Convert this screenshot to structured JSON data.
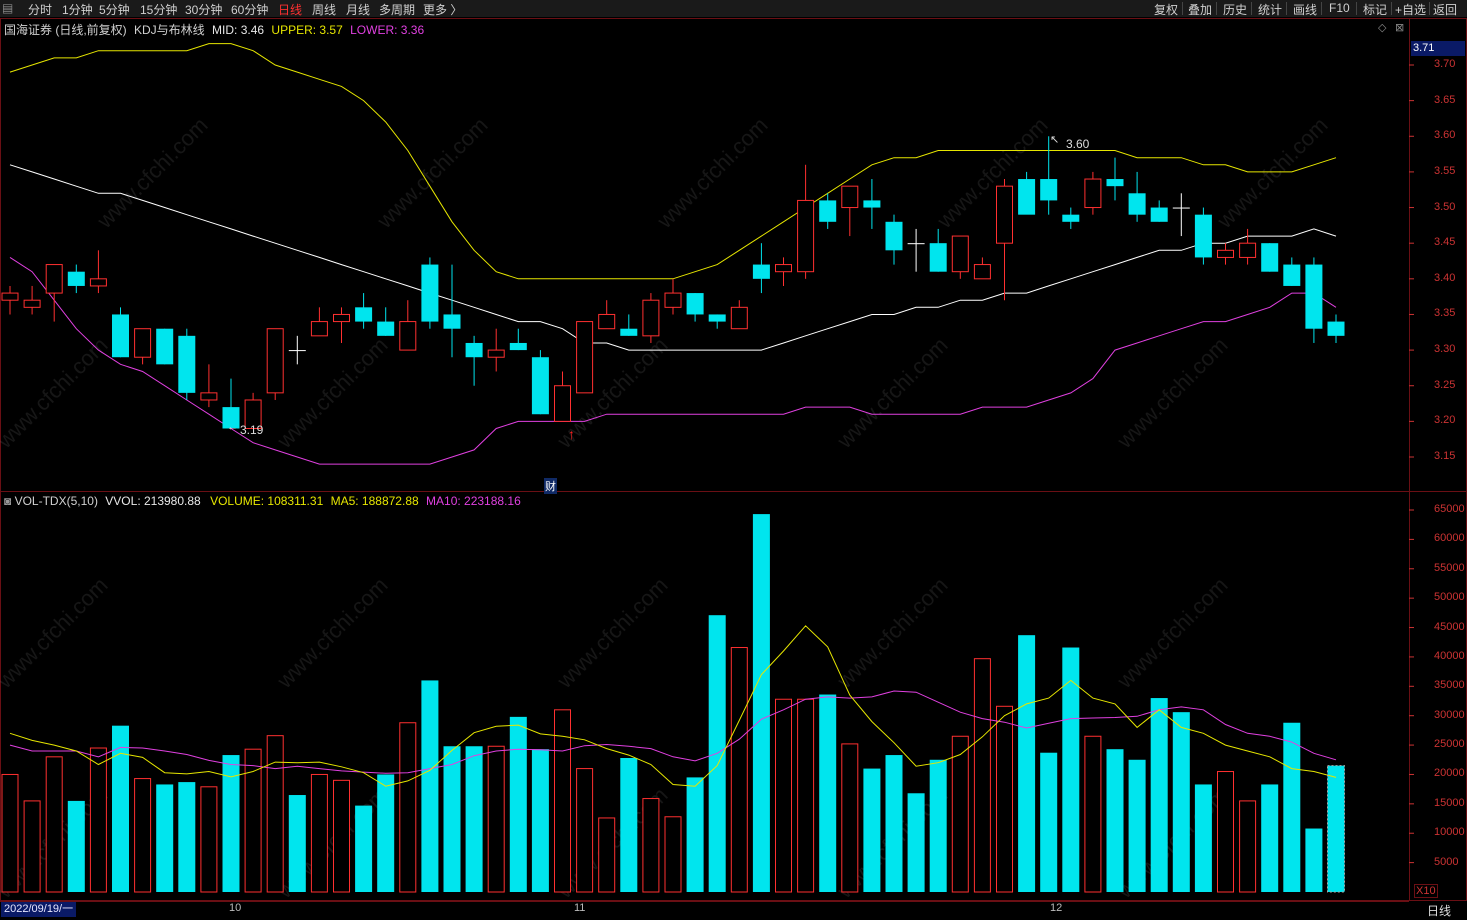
{
  "menu": {
    "periods": [
      "分时",
      "1分钟",
      "5分钟",
      "15分钟",
      "30分钟",
      "60分钟",
      "日线",
      "周线",
      "月线",
      "多周期",
      "更多 〉"
    ],
    "active": "日线",
    "right": [
      "复权",
      "叠加",
      "历史",
      "统计",
      "画线",
      "F10",
      "标记",
      "+自选",
      "返回"
    ]
  },
  "main_header": {
    "title": "国海证券 (日线,前复权)",
    "indicator": "KDJ与布林线",
    "mid": "MID: 3.46",
    "upper": "UPPER: 3.57",
    "lower": "LOWER: 3.36"
  },
  "vol_header": {
    "name": "VOL-TDX(5,10)",
    "vvol": "VVOL: 213980.88",
    "volume": "VOLUME: 108311.31",
    "ma5": "MA5: 188872.88",
    "ma10": "MA10: 223188.16"
  },
  "annotations": {
    "high": "3.60",
    "low": "3.19",
    "finance": "财"
  },
  "current_price": "3.71",
  "price_axis": [
    "3.70",
    "3.65",
    "3.60",
    "3.55",
    "3.50",
    "3.45",
    "3.40",
    "3.35",
    "3.30",
    "3.25",
    "3.20",
    "3.15"
  ],
  "vol_axis": [
    "65000",
    "60000",
    "55000",
    "50000",
    "45000",
    "40000",
    "35000",
    "30000",
    "25000",
    "20000",
    "15000",
    "10000",
    "5000"
  ],
  "vol_unit": "X10",
  "status": {
    "date": "2022/09/19/一",
    "months": [
      "10",
      "11",
      "12"
    ],
    "period": "日线"
  },
  "watermark": "www.cfchi.com",
  "colors": {
    "up": "#ff3030",
    "down": "#00e5ee",
    "mid": "#ffffff",
    "upper": "#e6e600",
    "lower": "#e040e0",
    "ma5": "#e6e600",
    "ma10": "#e040e0"
  },
  "chart_data": {
    "type": "candlestick",
    "candles": [
      [
        3.37,
        3.39,
        3.35,
        3.38
      ],
      [
        3.36,
        3.39,
        3.35,
        3.37
      ],
      [
        3.38,
        3.42,
        3.34,
        3.42
      ],
      [
        3.41,
        3.42,
        3.38,
        3.39
      ],
      [
        3.39,
        3.44,
        3.38,
        3.4
      ],
      [
        3.35,
        3.36,
        3.29,
        3.29
      ],
      [
        3.29,
        3.33,
        3.28,
        3.33
      ],
      [
        3.33,
        3.33,
        3.28,
        3.28
      ],
      [
        3.32,
        3.33,
        3.23,
        3.24
      ],
      [
        3.23,
        3.28,
        3.22,
        3.24
      ],
      [
        3.22,
        3.26,
        3.19,
        3.19
      ],
      [
        3.19,
        3.24,
        3.19,
        3.23
      ],
      [
        3.24,
        3.33,
        3.23,
        3.33
      ],
      [
        3.3,
        3.32,
        3.28,
        3.3
      ],
      [
        3.32,
        3.36,
        3.32,
        3.34
      ],
      [
        3.34,
        3.36,
        3.31,
        3.35
      ],
      [
        3.36,
        3.38,
        3.33,
        3.34
      ],
      [
        3.34,
        3.36,
        3.32,
        3.32
      ],
      [
        3.3,
        3.37,
        3.3,
        3.34
      ],
      [
        3.42,
        3.43,
        3.33,
        3.34
      ],
      [
        3.35,
        3.42,
        3.29,
        3.33
      ],
      [
        3.31,
        3.32,
        3.25,
        3.29
      ],
      [
        3.29,
        3.33,
        3.27,
        3.3
      ],
      [
        3.31,
        3.33,
        3.3,
        3.3
      ],
      [
        3.29,
        3.3,
        3.21,
        3.21
      ],
      [
        3.2,
        3.27,
        3.2,
        3.25
      ],
      [
        3.24,
        3.34,
        3.24,
        3.34
      ],
      [
        3.33,
        3.37,
        3.33,
        3.35
      ],
      [
        3.33,
        3.35,
        3.32,
        3.32
      ],
      [
        3.32,
        3.38,
        3.31,
        3.37
      ],
      [
        3.36,
        3.4,
        3.35,
        3.38
      ],
      [
        3.38,
        3.38,
        3.34,
        3.35
      ],
      [
        3.35,
        3.35,
        3.33,
        3.34
      ],
      [
        3.33,
        3.37,
        3.33,
        3.36
      ],
      [
        3.42,
        3.45,
        3.38,
        3.4
      ],
      [
        3.41,
        3.43,
        3.39,
        3.42
      ],
      [
        3.41,
        3.56,
        3.4,
        3.51
      ],
      [
        3.51,
        3.52,
        3.47,
        3.48
      ],
      [
        3.5,
        3.53,
        3.46,
        3.53
      ],
      [
        3.51,
        3.54,
        3.47,
        3.5
      ],
      [
        3.48,
        3.49,
        3.42,
        3.44
      ],
      [
        3.45,
        3.47,
        3.41,
        3.45
      ],
      [
        3.45,
        3.47,
        3.41,
        3.41
      ],
      [
        3.41,
        3.46,
        3.4,
        3.46
      ],
      [
        3.4,
        3.43,
        3.4,
        3.42
      ],
      [
        3.45,
        3.54,
        3.37,
        3.53
      ],
      [
        3.54,
        3.55,
        3.5,
        3.49
      ],
      [
        3.54,
        3.6,
        3.49,
        3.51
      ],
      [
        3.49,
        3.5,
        3.47,
        3.48
      ],
      [
        3.5,
        3.55,
        3.49,
        3.54
      ],
      [
        3.54,
        3.57,
        3.51,
        3.53
      ],
      [
        3.52,
        3.55,
        3.48,
        3.49
      ],
      [
        3.5,
        3.51,
        3.48,
        3.48
      ],
      [
        3.5,
        3.52,
        3.46,
        3.5
      ],
      [
        3.49,
        3.5,
        3.42,
        3.43
      ],
      [
        3.43,
        3.45,
        3.42,
        3.44
      ],
      [
        3.43,
        3.47,
        3.42,
        3.45
      ],
      [
        3.45,
        3.45,
        3.41,
        3.41
      ],
      [
        3.42,
        3.43,
        3.39,
        3.39
      ],
      [
        3.42,
        3.43,
        3.31,
        3.33
      ],
      [
        3.34,
        3.35,
        3.31,
        3.32
      ]
    ],
    "mid_line": [
      3.56,
      3.55,
      3.54,
      3.53,
      3.52,
      3.52,
      3.51,
      3.5,
      3.49,
      3.48,
      3.47,
      3.46,
      3.45,
      3.44,
      3.43,
      3.42,
      3.41,
      3.4,
      3.39,
      3.38,
      3.37,
      3.36,
      3.35,
      3.34,
      3.34,
      3.33,
      3.31,
      3.31,
      3.3,
      3.3,
      3.3,
      3.3,
      3.3,
      3.3,
      3.3,
      3.31,
      3.32,
      3.33,
      3.34,
      3.35,
      3.35,
      3.36,
      3.36,
      3.37,
      3.37,
      3.38,
      3.38,
      3.39,
      3.4,
      3.41,
      3.42,
      3.43,
      3.44,
      3.44,
      3.45,
      3.45,
      3.46,
      3.46,
      3.46,
      3.47,
      3.46
    ],
    "upper_line": [
      3.69,
      3.7,
      3.71,
      3.71,
      3.72,
      3.72,
      3.72,
      3.72,
      3.72,
      3.73,
      3.73,
      3.72,
      3.7,
      3.69,
      3.68,
      3.67,
      3.65,
      3.62,
      3.58,
      3.53,
      3.48,
      3.44,
      3.41,
      3.4,
      3.4,
      3.4,
      3.4,
      3.4,
      3.4,
      3.4,
      3.4,
      3.41,
      3.42,
      3.44,
      3.46,
      3.48,
      3.5,
      3.52,
      3.54,
      3.56,
      3.57,
      3.57,
      3.58,
      3.58,
      3.58,
      3.58,
      3.58,
      3.58,
      3.58,
      3.58,
      3.58,
      3.57,
      3.57,
      3.57,
      3.56,
      3.56,
      3.55,
      3.55,
      3.55,
      3.56,
      3.57
    ],
    "lower_line": [
      3.43,
      3.41,
      3.37,
      3.33,
      3.3,
      3.28,
      3.27,
      3.25,
      3.23,
      3.21,
      3.19,
      3.17,
      3.16,
      3.15,
      3.14,
      3.14,
      3.14,
      3.14,
      3.14,
      3.14,
      3.15,
      3.16,
      3.19,
      3.2,
      3.2,
      3.2,
      3.2,
      3.21,
      3.21,
      3.21,
      3.21,
      3.21,
      3.21,
      3.21,
      3.21,
      3.21,
      3.22,
      3.22,
      3.22,
      3.21,
      3.21,
      3.21,
      3.21,
      3.21,
      3.22,
      3.22,
      3.22,
      3.23,
      3.24,
      3.26,
      3.3,
      3.31,
      3.32,
      3.33,
      3.34,
      3.34,
      3.35,
      3.36,
      3.38,
      3.38,
      3.36
    ],
    "volume": [
      20000,
      15500,
      23000,
      15500,
      24500,
      28300,
      19300,
      18300,
      18700,
      17900,
      23300,
      24300,
      26600,
      16500,
      20000,
      19000,
      14700,
      20000,
      28800,
      36000,
      24800,
      24800,
      24800,
      29800,
      24300,
      31000,
      21000,
      12600,
      22800,
      15900,
      12800,
      19500,
      47100,
      41600,
      64300,
      32800,
      32800,
      33600,
      25200,
      21000,
      23300,
      16800,
      22500,
      26500,
      39700,
      31600,
      43700,
      23700,
      41600,
      26500,
      24300,
      22500,
      33000,
      30600,
      18300,
      20500,
      15500,
      18300,
      28800,
      10800,
      21500
    ],
    "ma5": [
      27000,
      25800,
      25000,
      24000,
      21700,
      23600,
      22900,
      20300,
      20100,
      20500,
      19600,
      20500,
      22100,
      22000,
      22100,
      21300,
      20300,
      18000,
      18900,
      20700,
      24100,
      27100,
      28200,
      28400,
      26900,
      26500,
      25900,
      24400,
      23300,
      21700,
      18300,
      18000,
      21500,
      29200,
      37000,
      41000,
      45300,
      41700,
      33500,
      29000,
      25400,
      21400,
      22000,
      23400,
      26400,
      30000,
      32000,
      33000,
      36000,
      33000,
      32000,
      28000,
      31000,
      28000,
      27000,
      25000,
      24000,
      23000,
      21000,
      20500,
      19500
    ],
    "ma10": [
      25000,
      24000,
      24000,
      24000,
      23000,
      24600,
      24500,
      24000,
      23400,
      22400,
      21700,
      21500,
      21000,
      21400,
      21000,
      20600,
      20400,
      20200,
      20300,
      21000,
      21700,
      23200,
      24000,
      24300,
      24200,
      24000,
      24900,
      25100,
      24800,
      24400,
      23000,
      22300,
      23600,
      26000,
      29400,
      31000,
      32800,
      33200,
      33000,
      33200,
      34200,
      34000,
      32300,
      30600,
      29500,
      28900,
      27900,
      28700,
      29500,
      29600,
      29700,
      29900,
      31000,
      31500,
      31000,
      28500,
      27000,
      26500,
      25500,
      23600,
      22500
    ]
  }
}
